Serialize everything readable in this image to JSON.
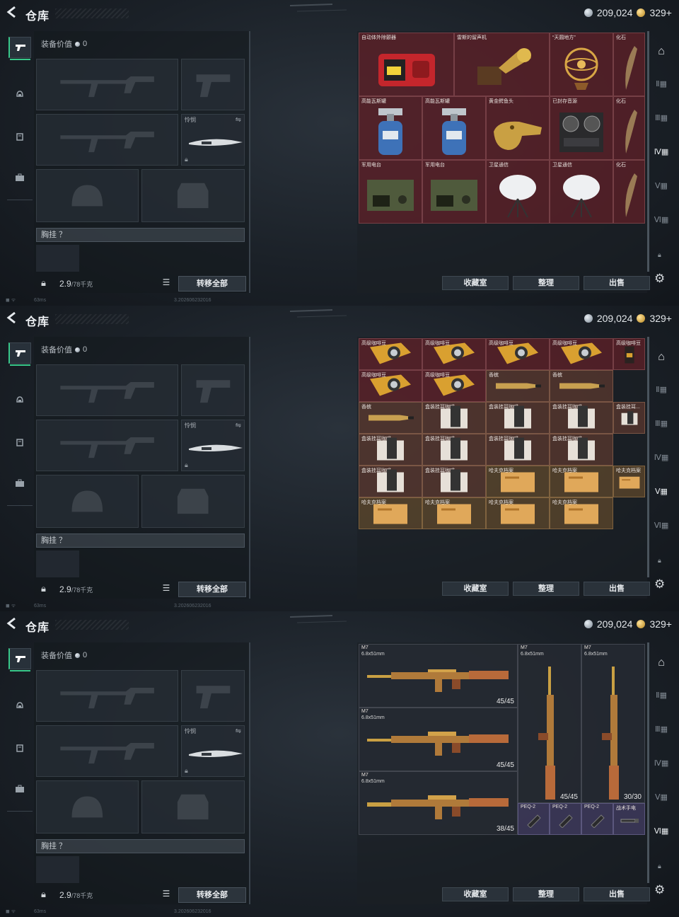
{
  "header": {
    "back": "<",
    "title": "仓库",
    "currency_silver": "209,024",
    "currency_gold": "329+"
  },
  "equip": {
    "value_label": "装备价值",
    "value": "0",
    "knife_label": "怜悯",
    "chest_label": "胸挂 ？",
    "weight_value": "2.9",
    "weight_max": "/78千克",
    "transfer_button": "转移全部"
  },
  "actions": {
    "collection": "收藏室",
    "sort": "整理",
    "sell": "出售"
  },
  "status": {
    "ping": "63ms",
    "build": "3.202606232016"
  },
  "panel1": {
    "cells": [
      {
        "label": "自动体外除颤器"
      },
      {
        "label": "雷斯的留声机"
      },
      {
        "label": "“天圆地方”"
      },
      {
        "label": "化石"
      },
      {
        "label": "高能瓦斯罐"
      },
      {
        "label": "高能瓦斯罐"
      },
      {
        "label": "黄金鳄鱼头"
      },
      {
        "label": "已封存音源"
      },
      {
        "label": "化石"
      },
      {
        "label": "军用电台"
      },
      {
        "label": "军用电台"
      },
      {
        "label": "卫星通信"
      },
      {
        "label": "卫星通信"
      },
      {
        "label": "化石"
      }
    ]
  },
  "panel2": {
    "cells": [
      {
        "label": "高级咖啡豆"
      },
      {
        "label": "高级咖啡豆"
      },
      {
        "label": "高级咖啡豆"
      },
      {
        "label": "高级咖啡豆"
      },
      {
        "label": "高级咖啡豆"
      },
      {
        "label": "高级咖啡豆"
      },
      {
        "label": "高级咖啡豆"
      },
      {
        "label": "香槟"
      },
      {
        "label": "香槟"
      },
      {
        "label": "香槟"
      },
      {
        "label": "盒装挂耳咖啡"
      },
      {
        "label": "盒装挂耳咖啡"
      },
      {
        "label": "盒装挂耳咖啡"
      },
      {
        "label": "盒装挂耳..."
      },
      {
        "label": "盒装挂耳咖啡"
      },
      {
        "label": "盒装挂耳咖啡"
      },
      {
        "label": "盒装挂耳咖啡"
      },
      {
        "label": "盒装挂耳咖啡"
      },
      {
        "label": "盒装挂耳咖啡"
      },
      {
        "label": "盒装挂耳咖啡"
      },
      {
        "label": "哈夫克档案"
      },
      {
        "label": "哈夫克档案"
      },
      {
        "label": "哈夫克档案"
      },
      {
        "label": "哈夫克档案"
      },
      {
        "label": "哈夫克档案"
      },
      {
        "label": "哈夫克档案"
      },
      {
        "label": "哈夫克档案"
      },
      {
        "label": "哈夫克档案"
      }
    ]
  },
  "panel3": {
    "rifles": [
      {
        "name": "M7",
        "caliber": "6.8x51mm",
        "ammo": "45/45"
      },
      {
        "name": "M7",
        "caliber": "6.8x51mm",
        "ammo": "45/45"
      },
      {
        "name": "M7",
        "caliber": "6.8x51mm",
        "ammo": "38/45"
      },
      {
        "name": "M7",
        "caliber": "6.8x51mm",
        "ammo": "45/45"
      },
      {
        "name": "M7",
        "caliber": "6.8x51mm",
        "ammo": "30/30"
      }
    ],
    "accessories": [
      {
        "label": "PEQ-2"
      },
      {
        "label": "PEQ-2"
      },
      {
        "label": "PEQ-2"
      },
      {
        "label": "战术手电"
      }
    ]
  },
  "colors": {
    "accent_green": "#38c88a",
    "rare_red": "#702028",
    "legend_gold": "#b8861e"
  }
}
